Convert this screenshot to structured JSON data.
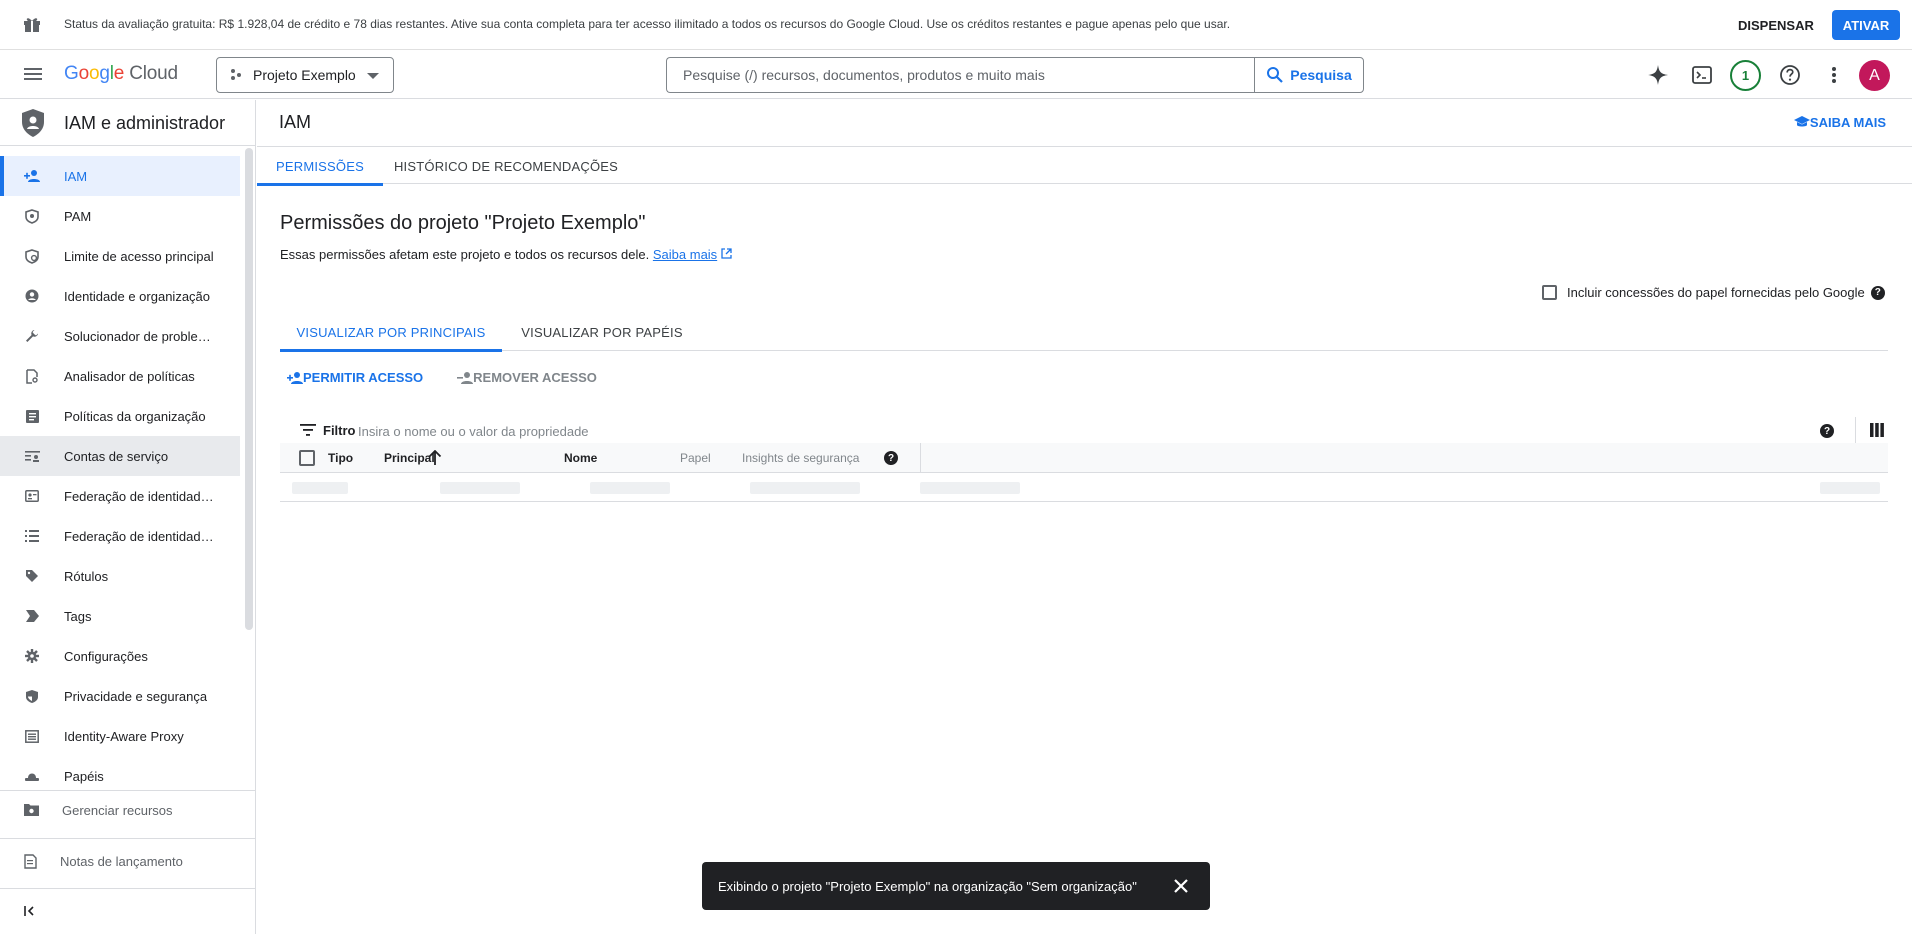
{
  "banner": {
    "text": "Status da avaliação gratuita: R$ 1.928,04 de crédito e 78 dias restantes. Ative sua conta completa para ter acesso ilimitado a todos os recursos do Google Cloud. Use os créditos restantes e pague apenas pelo que usar.",
    "dismiss": "DISPENSAR",
    "activate": "ATIVAR"
  },
  "header": {
    "logo_google": [
      "G",
      "o",
      "o",
      "g",
      "l",
      "e"
    ],
    "logo_cloud": "Cloud",
    "project": "Projeto Exemplo",
    "search_placeholder": "Pesquise (/) recursos, documentos, produtos e muito mais",
    "search_button": "Pesquisa",
    "notification_count": "1",
    "avatar_letter": "A"
  },
  "sidebar": {
    "title": "IAM e administrador",
    "items": [
      {
        "label": "IAM",
        "icon": "person-add-icon"
      },
      {
        "label": "PAM",
        "icon": "shield-lock-icon"
      },
      {
        "label": "Limite de acesso principal",
        "icon": "policy-icon"
      },
      {
        "label": "Identidade e organização",
        "icon": "account-circle-icon"
      },
      {
        "label": "Solucionador de problem…",
        "icon": "wrench-icon"
      },
      {
        "label": "Analisador de políticas",
        "icon": "document-search-icon"
      },
      {
        "label": "Políticas da organização",
        "icon": "article-icon"
      },
      {
        "label": "Contas de serviço",
        "icon": "service-account-icon"
      },
      {
        "label": "Federação de identidade …",
        "icon": "badge-icon"
      },
      {
        "label": "Federação de identidade …",
        "icon": "list-icon"
      },
      {
        "label": "Rótulos",
        "icon": "label-icon"
      },
      {
        "label": "Tags",
        "icon": "tag-icon"
      },
      {
        "label": "Configurações",
        "icon": "gear-icon"
      },
      {
        "label": "Privacidade e segurança",
        "icon": "security-icon"
      },
      {
        "label": "Identity-Aware Proxy",
        "icon": "proxy-icon"
      },
      {
        "label": "Papéis",
        "icon": "hat-icon"
      }
    ],
    "manage_resources": "Gerenciar recursos",
    "release_notes": "Notas de lançamento"
  },
  "main": {
    "title": "IAM",
    "learn_more": "SAIBA MAIS",
    "tabs": [
      "PERMISSÕES",
      "HISTÓRICO DE RECOMENDAÇÕES"
    ],
    "heading": "Permissões do projeto \"Projeto Exemplo\"",
    "description": "Essas permissões afetam este projeto e todos os recursos dele.",
    "description_link": "Saiba mais",
    "include_google_grants": "Incluir concessões do papel fornecidas pelo Google",
    "view_tabs": [
      "VISUALIZAR POR PRINCIPAIS",
      "VISUALIZAR POR PAPÉIS"
    ],
    "grant_access": "PERMITIR ACESSO",
    "remove_access": "REMOVER ACESSO",
    "filter_label": "Filtro",
    "filter_placeholder": "Insira o nome ou o valor da propriedade",
    "columns": [
      "Tipo",
      "Principal",
      "Nome",
      "Papel",
      "Insights de segurança"
    ]
  },
  "snackbar": {
    "text": "Exibindo o projeto \"Projeto Exemplo\" na organização \"Sem organização\""
  },
  "colors": {
    "accent": "#1a73e8",
    "avatar": "#c2185b",
    "badge": "#188038"
  }
}
